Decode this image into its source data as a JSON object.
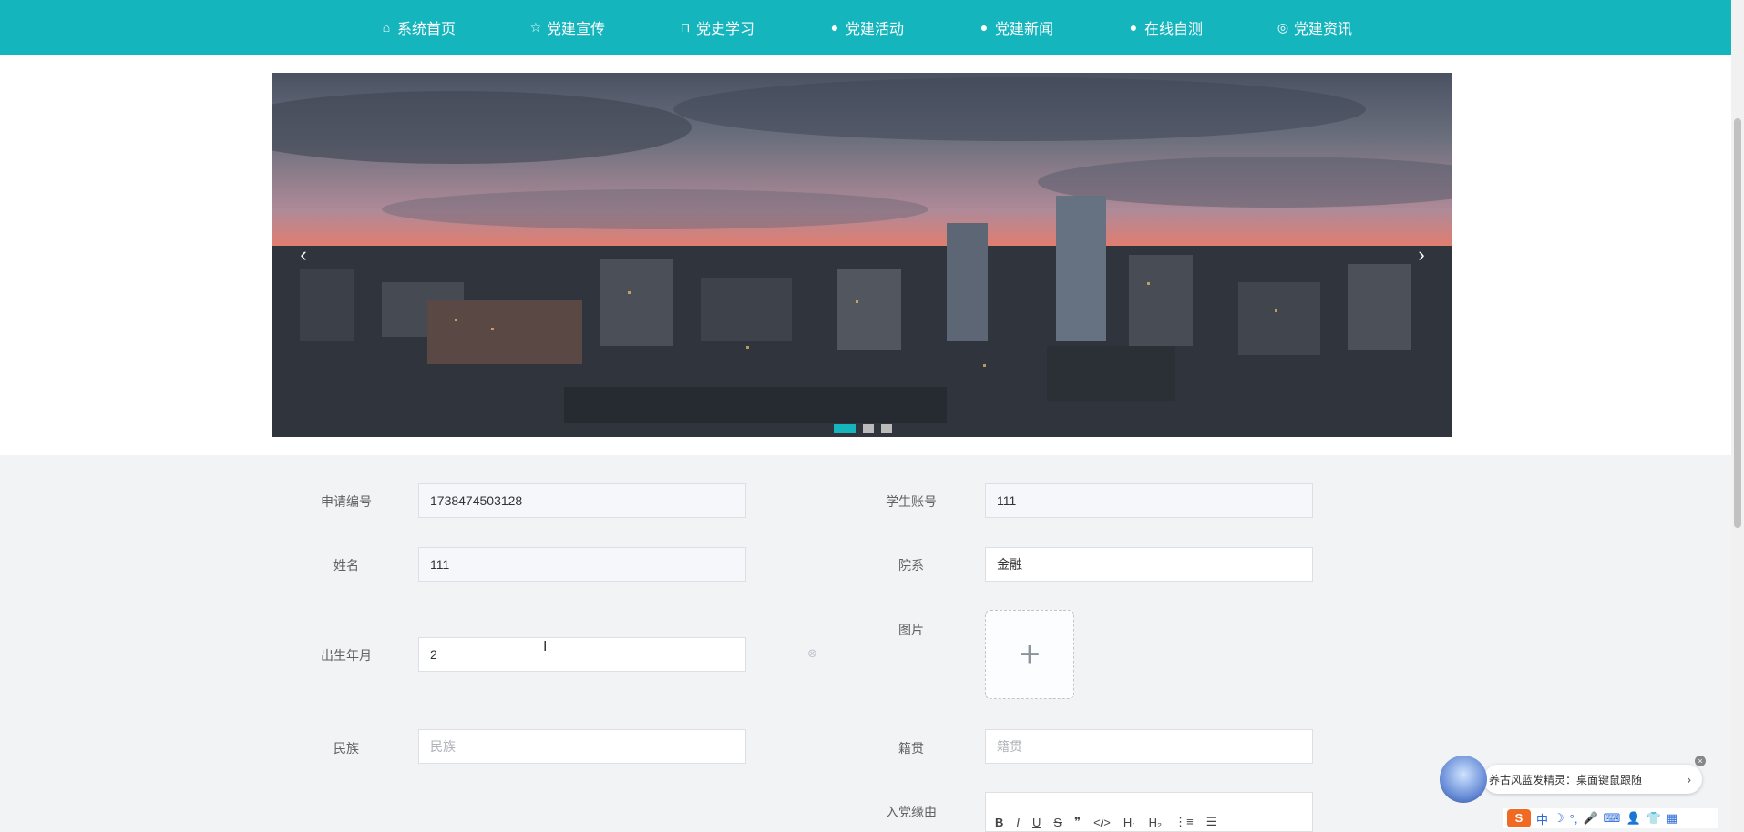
{
  "nav": {
    "items": [
      {
        "icon": "home-icon",
        "glyph": "⌂",
        "label": "系统首页"
      },
      {
        "icon": "star-icon",
        "glyph": "☆",
        "label": "党建宣传"
      },
      {
        "icon": "bag-icon",
        "glyph": "⊓",
        "label": "党史学习"
      },
      {
        "icon": "alert-icon",
        "glyph": "●",
        "label": "党建活动"
      },
      {
        "icon": "help-icon",
        "glyph": "●",
        "label": "党建新闻"
      },
      {
        "icon": "info-icon",
        "glyph": "●",
        "label": "在线自测"
      },
      {
        "icon": "globe-icon",
        "glyph": "◎",
        "label": "党建资讯"
      }
    ]
  },
  "carousel": {
    "prev": "‹",
    "next": "›",
    "slides": 3,
    "active_index": 0
  },
  "form": {
    "application_no_label": "申请编号",
    "application_no_value": "1738474503128",
    "student_account_label": "学生账号",
    "student_account_value": "111",
    "name_label": "姓名",
    "name_value": "111",
    "department_label": "院系",
    "department_value": "金融",
    "birth_label": "出生年月",
    "birth_value": "2",
    "picture_label": "图片",
    "ethnicity_label": "民族",
    "ethnicity_placeholder": "民族",
    "native_place_label": "籍贯",
    "native_place_placeholder": "籍贯",
    "reason_label": "入党缘由"
  },
  "editor": {
    "buttons": [
      "B",
      "I",
      "U",
      "S",
      "❞",
      "</>",
      "H₁",
      "H₂",
      "⋮≡",
      "☰"
    ]
  },
  "widget": {
    "text": "养古风蓝发精灵：桌面键鼠跟随",
    "close": "×",
    "arrow": "›"
  },
  "ime": {
    "logo": "S",
    "items": [
      "中",
      "☽",
      "°,",
      "🎤",
      "⌨",
      "👤",
      "👕",
      "▦"
    ]
  },
  "colors": {
    "accent": "#14b5bd"
  }
}
